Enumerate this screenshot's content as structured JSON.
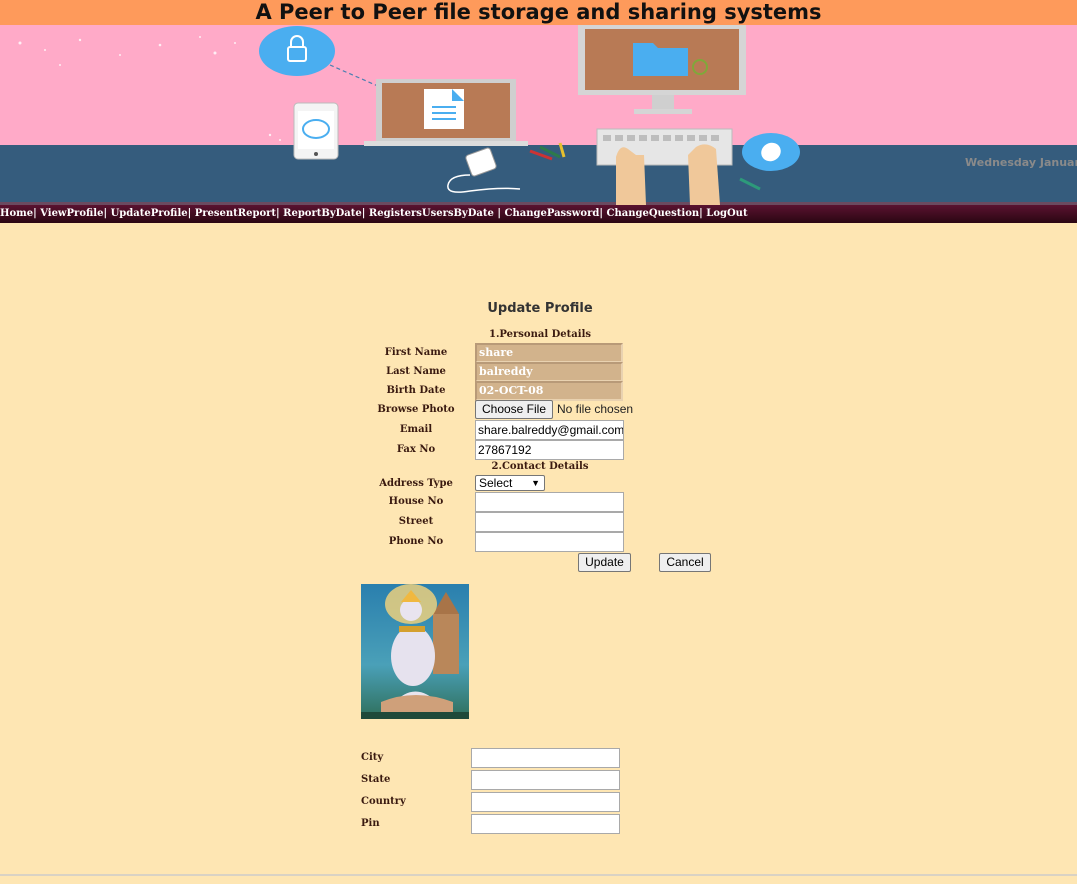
{
  "header": {
    "title": "A Peer to Peer file storage and sharing systems",
    "date_text": "Wednesday Januar"
  },
  "nav": [
    {
      "label": "Home"
    },
    {
      "label": "ViewProfile"
    },
    {
      "label": "UpdateProfile"
    },
    {
      "label": "PresentReport"
    },
    {
      "label": "ReportByDate"
    },
    {
      "label": "RegistersUsersByDate"
    },
    {
      "label": "ChangePassword"
    },
    {
      "label": "ChangeQuestion"
    },
    {
      "label": "LogOut"
    }
  ],
  "form": {
    "title": "Update Profile",
    "section_personal": "1.Personal Details",
    "section_contact": "2.Contact Details",
    "first_name_label": "First Name",
    "first_name_value": "share",
    "last_name_label": "Last Name",
    "last_name_value": "balreddy",
    "birth_date_label": "Birth Date",
    "birth_date_value": "02-OCT-08",
    "browse_photo_label": "Browse Photo",
    "choose_file_label": "Choose File",
    "no_file_text": "No file chosen",
    "email_label": "Email",
    "email_value": "share.balreddy@gmail.com",
    "fax_label": "Fax No",
    "fax_value": "27867192",
    "address_type_label": "Address Type",
    "address_type_selected": "Select",
    "house_no_label": "House No",
    "street_label": "Street",
    "phone_no_label": "Phone No",
    "update_label": "Update",
    "cancel_label": "Cancel",
    "city_label": "City",
    "state_label": "State",
    "country_label": "Country",
    "pin_label": "Pin"
  },
  "colors": {
    "title_bar": "#fe9a5b",
    "page_bg": "#fee6b3",
    "banner_pink": "#ffaac8",
    "banner_floor": "#355c7d",
    "nav_bg": "#3a0a1c"
  }
}
